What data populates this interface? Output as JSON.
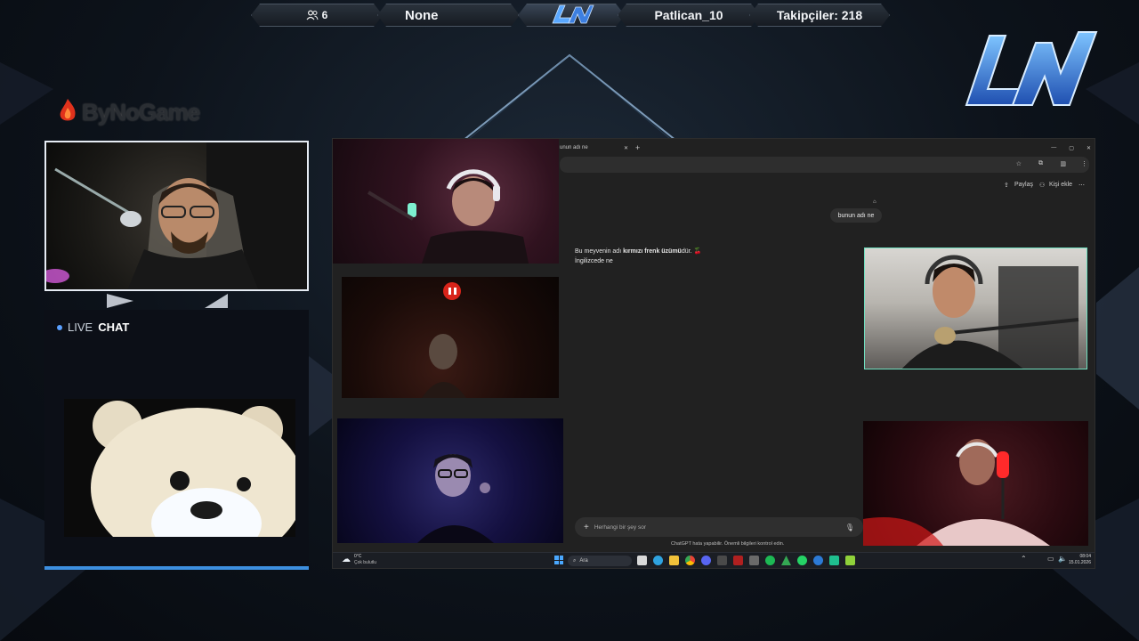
{
  "top_bar": {
    "viewer_count": "6",
    "title": "None",
    "streamer": "Patlican_10",
    "followers": "Takipçiler: 218"
  },
  "sponsor": {
    "name": "ByNoGame"
  },
  "live_chat": {
    "live": "LIVE",
    "chat": "CHAT"
  },
  "browser": {
    "tab_title": "unun adı ne",
    "share_label": "Paylaş",
    "add_person_label": "Kişi ekle"
  },
  "chatgpt": {
    "user_message": "bunun adı ne",
    "reply_part1": "Bu meyvenin adı ",
    "reply_bold": "kırmızı frenk üzümü",
    "reply_part2": "dür. 🍒",
    "followup": "İngilizcede ne",
    "input_placeholder": "Herhangi bir şey sor",
    "disclaimer": "ChatGPT hata yapabilir. Önemli bilgileri kontrol edin."
  },
  "taskbar": {
    "weather_temp": "0°C",
    "weather_desc": "Çok bulutlu",
    "search_label": "Ara",
    "time": "08:04",
    "date": "15.01.2026"
  },
  "colors": {
    "accent_blue": "#3d8fe0",
    "frame_white": "#e6ecf4",
    "cam_border_green": "#6fe0c0"
  }
}
